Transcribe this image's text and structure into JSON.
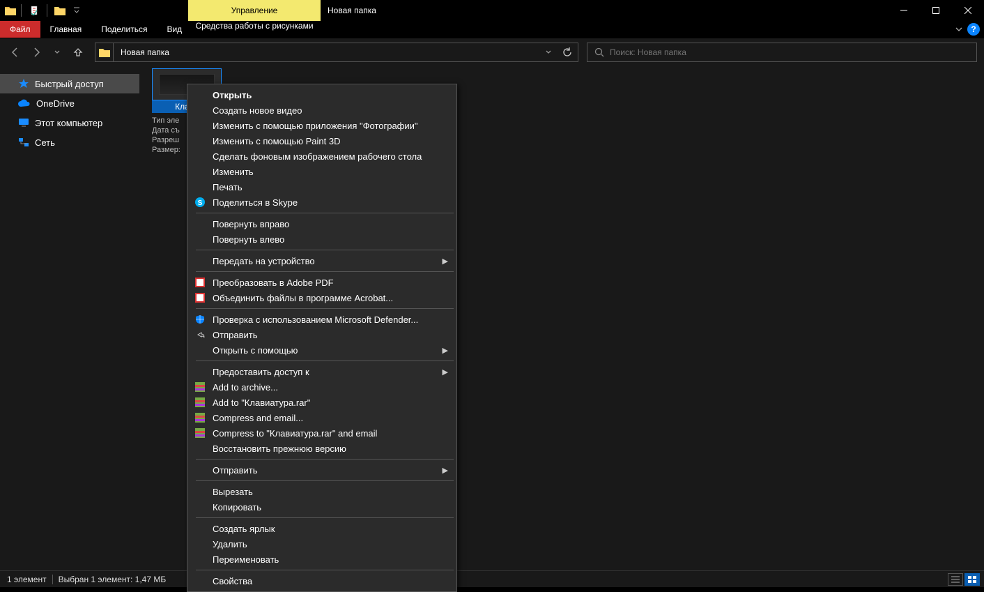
{
  "title": {
    "context_tab": "Управление",
    "window_title": "Новая папка"
  },
  "ribbon": {
    "file": "Файл",
    "tabs": [
      "Главная",
      "Поделиться",
      "Вид"
    ],
    "tools_tab": "Средства работы с рисунками"
  },
  "nav": {
    "path": "Новая папка",
    "search_placeholder": "Поиск: Новая папка"
  },
  "sidebar": {
    "quick_access": "Быстрый доступ",
    "onedrive": "OneDrive",
    "this_pc": "Этот компьютер",
    "network": "Сеть"
  },
  "tile": {
    "name": "Клави",
    "line1": "Тип эле",
    "line2": "Дата съ",
    "line3": "Разреш",
    "line4": "Размер:"
  },
  "context_menu": {
    "open": "Открыть",
    "create_video": "Создать новое видео",
    "edit_photos": "Изменить с помощью приложения \"Фотографии\"",
    "edit_paint3d": "Изменить с помощью Paint 3D",
    "set_wallpaper": "Сделать фоновым изображением рабочего стола",
    "edit": "Изменить",
    "print": "Печать",
    "share_skype": "Поделиться в Skype",
    "rotate_right": "Повернуть вправо",
    "rotate_left": "Повернуть влево",
    "cast": "Передать на устройство",
    "adobe_pdf": "Преобразовать в Adobe PDF",
    "acrobat_combine": "Объединить файлы в программе Acrobat...",
    "defender": "Проверка с использованием Microsoft Defender...",
    "share": "Отправить",
    "open_with": "Открыть с помощью",
    "give_access": "Предоставить доступ к",
    "add_archive": "Add to archive...",
    "add_rar": "Add to \"Клавиатура.rar\"",
    "compress_email": "Compress and email...",
    "compress_rar_email": "Compress to \"Клавиатура.rar\" and email",
    "restore_version": "Восстановить прежнюю версию",
    "send_to": "Отправить",
    "cut": "Вырезать",
    "copy": "Копировать",
    "create_shortcut": "Создать ярлык",
    "delete": "Удалить",
    "rename": "Переименовать",
    "properties": "Свойства"
  },
  "status": {
    "count": "1 элемент",
    "selected": "Выбран 1 элемент: 1,47 МБ"
  }
}
